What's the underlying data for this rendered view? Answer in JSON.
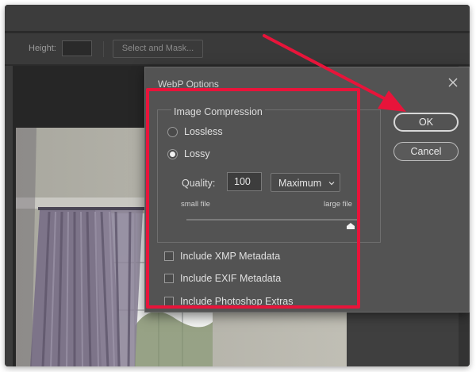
{
  "options_bar": {
    "height_label": "Height:",
    "height_value": "",
    "select_mask_label": "Select and Mask..."
  },
  "dialog": {
    "title": "WebP Options",
    "group_title": "Image Compression",
    "compression": {
      "lossless_label": "Lossless",
      "lossy_label": "Lossy",
      "selected": "Lossy"
    },
    "quality": {
      "label": "Quality:",
      "value": "100",
      "preset": "Maximum",
      "small_label": "small file",
      "large_label": "large file",
      "slider_fraction": 0.95
    },
    "metadata": [
      {
        "label": "Include XMP Metadata",
        "checked": false
      },
      {
        "label": "Include EXIF Metadata",
        "checked": false
      },
      {
        "label": "Include Photoshop Extras",
        "checked": false
      }
    ],
    "ok_label": "OK",
    "cancel_label": "Cancel"
  },
  "icons": {
    "close": "close-icon",
    "chevron": "chevron-down-icon",
    "slider_thumb": "slider-thumb-icon"
  },
  "colors": {
    "highlight": "#e8143a",
    "arrow": "#e8143a",
    "dialog_bg": "#535353",
    "app_bg": "#2b2b2b"
  }
}
